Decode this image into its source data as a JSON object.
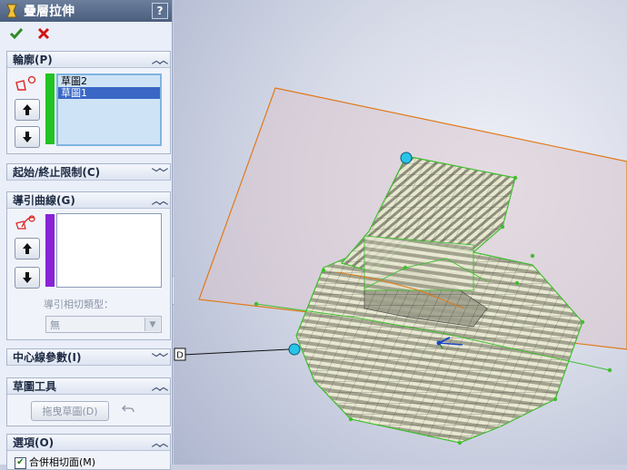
{
  "panel": {
    "title": "疊層拉伸",
    "help_label": "?",
    "ok_icon": "check-icon",
    "cancel_icon": "close-icon"
  },
  "profiles": {
    "header": "輪廓(P)",
    "items": [
      "草圖2",
      "草圖1"
    ],
    "selected_index": 1,
    "color_bar": "#22c322"
  },
  "start_end": {
    "header": "起始/終止限制(C)"
  },
  "guides": {
    "header": "導引曲線(G)",
    "color_bar": "#8a22d6",
    "tangency_label": "導引相切類型：",
    "tangency_value": "無"
  },
  "centerline": {
    "header": "中心線參數(I)"
  },
  "sketch_tools": {
    "header": "草圖工具",
    "drag_label": "拖曳草圖(D)",
    "undo_icon": "undo-icon"
  },
  "options": {
    "header": "選項(O)",
    "merge_tangent_label": "合併相切面(M)",
    "merge_tangent_checked": true
  },
  "viewport": {
    "callout_label": "D",
    "accent_plane": "#e07a1a",
    "edge_color": "#3fbf2f",
    "point_color": "#28c4e8"
  }
}
